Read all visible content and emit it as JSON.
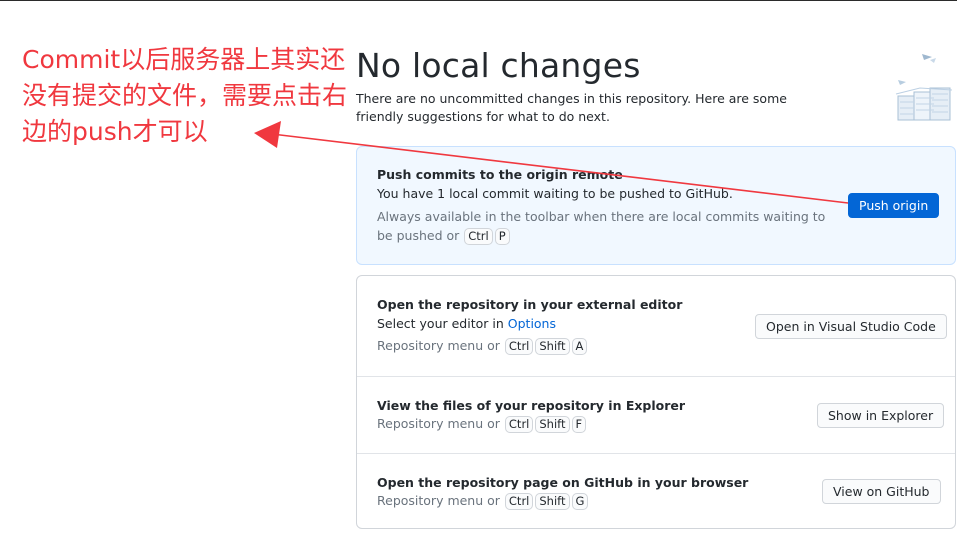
{
  "header": {
    "title": "No local changes",
    "intro": "There are no uncommitted changes in this repository. Here are some friendly suggestions for what to do next."
  },
  "push_card": {
    "title": "Push commits to the origin remote",
    "description": "You have 1 local commit waiting to be pushed to GitHub.",
    "hint_prefix": "Always available in the toolbar when there are local commits waiting to be pushed or",
    "keys": [
      "Ctrl",
      "P"
    ],
    "button": "Push origin"
  },
  "editor_card": {
    "title": "Open the repository in your external editor",
    "description_prefix": "Select your editor in",
    "description_link": "Options",
    "hint_prefix": "Repository menu or",
    "keys": [
      "Ctrl",
      "Shift",
      "A"
    ],
    "button": "Open in Visual Studio Code"
  },
  "explorer_card": {
    "title": "View the files of your repository in Explorer",
    "hint_prefix": "Repository menu or",
    "keys": [
      "Ctrl",
      "Shift",
      "F"
    ],
    "button": "Show in Explorer"
  },
  "github_card": {
    "title": "Open the repository page on GitHub in your browser",
    "hint_prefix": "Repository menu or",
    "keys": [
      "Ctrl",
      "Shift",
      "G"
    ],
    "button": "View on GitHub"
  },
  "annotation": {
    "text": "Commit以后服务器上其实还没有提交的文件，需要点击右边的push才可以",
    "color": "#f0383f"
  },
  "colors": {
    "accent": "#0366d6",
    "primary_card_bg": "#f1f8ff"
  }
}
